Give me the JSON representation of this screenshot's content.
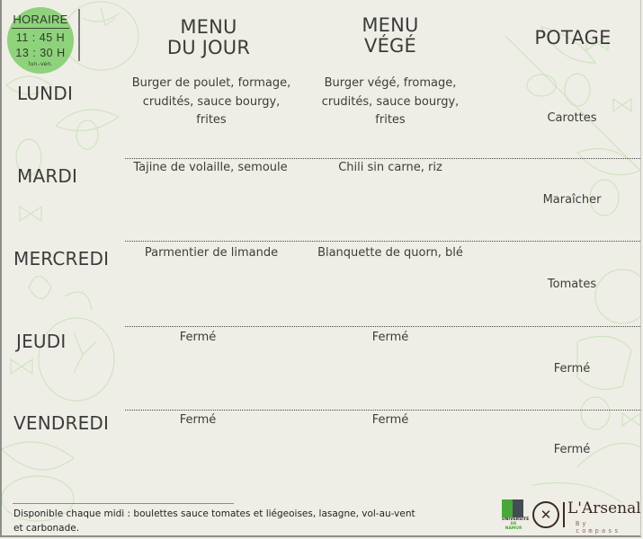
{
  "schedule": {
    "title": "HORAIRE",
    "open": "11 : 45 H",
    "close": "13 : 30 H",
    "days": "lun.-ven."
  },
  "columns": {
    "menu_du_jour": {
      "line1": "MENU",
      "line2": "DU JOUR"
    },
    "menu_vege": {
      "line1": "MENU",
      "line2": "VÉGÉ"
    },
    "potage": "POTAGE"
  },
  "days": [
    {
      "name": "LUNDI",
      "menu_du_jour": "Burger de poulet, formage, crudités, sauce bourgy, frites",
      "menu_vege": "Burger végé, fromage, crudités, sauce bourgy, frites",
      "potage": "Carottes"
    },
    {
      "name": "MARDI",
      "menu_du_jour": "Tajine de volaille, semoule",
      "menu_vege": "Chili sin carne, riz",
      "potage": "Maraîcher"
    },
    {
      "name": "MERCREDI",
      "menu_du_jour": "Parmentier de limande",
      "menu_vege": "Blanquette de quorn, blé",
      "potage": "Tomates"
    },
    {
      "name": "JEUDI",
      "menu_du_jour": "Fermé",
      "menu_vege": "Fermé",
      "potage": "Fermé"
    },
    {
      "name": "VENDREDI",
      "menu_du_jour": "Fermé",
      "menu_vege": "Fermé",
      "potage": "Fermé"
    }
  ],
  "footer": {
    "text": "Disponible chaque midi : boulettes sauce tomates et liégeoises, lasagne, vol-au-vent et carbonade."
  },
  "logos": {
    "university": {
      "line1": "UNIVERSITÉ",
      "line2": "DE NAMUR"
    },
    "restaurant": {
      "name": "L'Arsenal",
      "tagline": "By compass"
    }
  },
  "colors": {
    "background": "#efeee6",
    "badge_green": "#8ed27c",
    "text": "#3b3b3b",
    "unamur_green": "#4aa73a",
    "arsenal_brown": "#3a2a22"
  }
}
